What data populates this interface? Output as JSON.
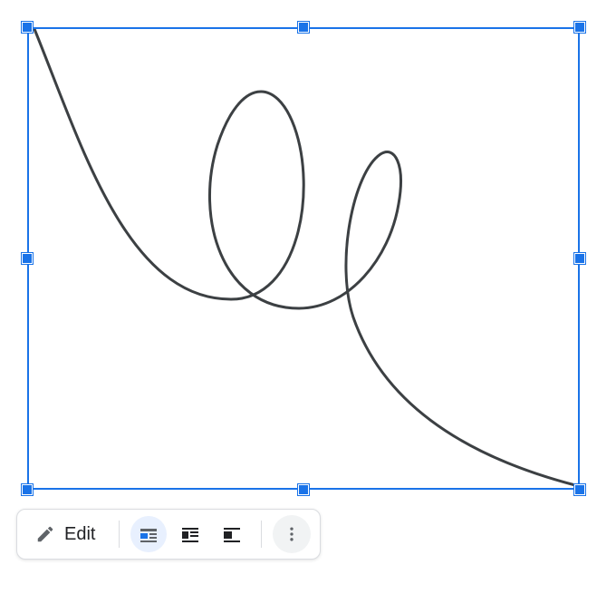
{
  "selection": {
    "accent_color": "#1a73e8",
    "drawing_stroke": "#3c4043"
  },
  "toolbar": {
    "edit_label": "Edit",
    "edit_icon": "pencil-icon",
    "wrap_options": [
      {
        "name": "inline-wrap-icon",
        "active": true
      },
      {
        "name": "wrap-text-icon",
        "active": false
      },
      {
        "name": "break-text-icon",
        "active": false
      }
    ],
    "more_icon": "more-vertical-icon"
  }
}
